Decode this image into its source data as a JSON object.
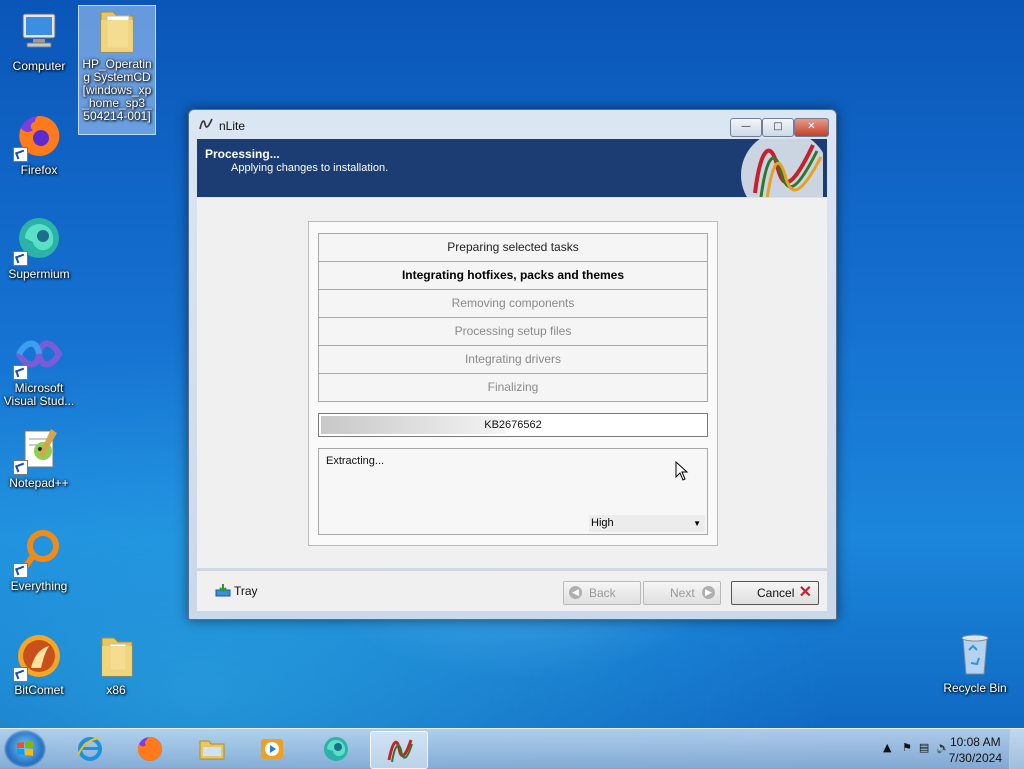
{
  "desktop": {
    "icons": [
      {
        "label": "Computer"
      },
      {
        "label": "HP_Operating SystemCD[windows_xp_home_sp3_504214-001]"
      },
      {
        "label": "Firefox"
      },
      {
        "label": "Supermium"
      },
      {
        "label": "Microsoft Visual Stud..."
      },
      {
        "label": "Notepad++"
      },
      {
        "label": "Everything"
      },
      {
        "label": "BitComet"
      },
      {
        "label": "x86"
      },
      {
        "label": "Recycle Bin"
      }
    ]
  },
  "window": {
    "title": "nLite",
    "title_icon": "nlite-icon",
    "header": {
      "title": "Processing...",
      "subtitle": "Applying changes to installation."
    },
    "steps": [
      {
        "label": "Preparing selected tasks",
        "state": "done"
      },
      {
        "label": "Integrating hotfixes, packs and themes",
        "state": "active"
      },
      {
        "label": "Removing components",
        "state": "pending"
      },
      {
        "label": "Processing setup files",
        "state": "pending"
      },
      {
        "label": "Integrating drivers",
        "state": "pending"
      },
      {
        "label": "Finalizing",
        "state": "pending"
      }
    ],
    "progress": {
      "label": "KB2676562",
      "fraction": 0.48
    },
    "log": {
      "text": "Extracting..."
    },
    "priority": {
      "selected": "High"
    },
    "footer": {
      "tray_label": "Tray",
      "back_label": "Back",
      "next_label": "Next",
      "cancel_label": "Cancel"
    }
  },
  "taskbar": {
    "apps": [
      "Internet Explorer",
      "Firefox",
      "File Explorer",
      "Media Player",
      "Supermium",
      "nLite"
    ],
    "clock": {
      "time": "10:08 AM",
      "date": "7/30/2024"
    }
  },
  "colors": {
    "header_bg": "#1c3d74",
    "cancel_x": "#c8202a"
  }
}
